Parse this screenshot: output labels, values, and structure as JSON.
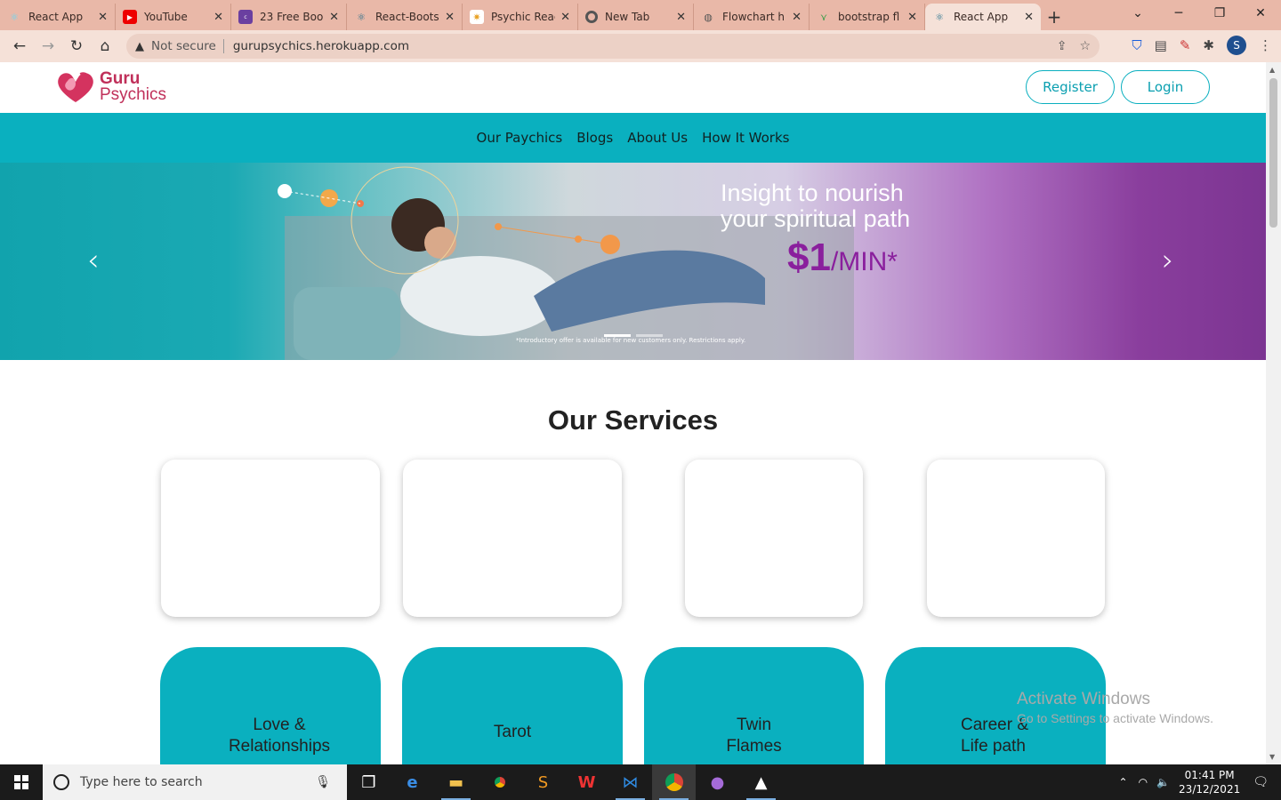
{
  "browser": {
    "tabs": [
      {
        "title": "React App",
        "icon": "react-icon",
        "active": false
      },
      {
        "title": "YouTube",
        "icon": "youtube-icon",
        "active": false
      },
      {
        "title": "23 Free Boo",
        "icon": "colorlib-icon",
        "active": false
      },
      {
        "title": "React-Boots",
        "icon": "react-icon",
        "active": false
      },
      {
        "title": "Psychic Reac",
        "icon": "psychic-icon",
        "active": false
      },
      {
        "title": "New Tab",
        "icon": "chrome-icon",
        "active": false
      },
      {
        "title": "Flowchart h",
        "icon": "globe-icon",
        "active": false
      },
      {
        "title": "bootstrap fl",
        "icon": "bootstrap-icon",
        "active": false
      },
      {
        "title": "React App",
        "icon": "react-icon",
        "active": true
      }
    ],
    "not_secure": "Not secure",
    "url": "gurupsychics.herokuapp.com",
    "profile_initial": "S"
  },
  "site": {
    "logo_line1": "Guru",
    "logo_line2": "Psychics",
    "register_label": "Register",
    "login_label": "Login",
    "nav": [
      "Our Paychics",
      "Blogs",
      "About Us",
      "How It Works"
    ],
    "hero": {
      "headline_1": "Insight to nourish",
      "headline_2": "your spiritual path",
      "price": "$1",
      "per": "/MIN*",
      "fine_print": "*Introductory offer is available for new customers only. Restrictions apply."
    },
    "services_title": "Our Services",
    "services": [
      {
        "line1": "Love &",
        "line2": "Relationships"
      },
      {
        "line1": "",
        "line2": "Tarot"
      },
      {
        "line1": "Twin",
        "line2": "Flames"
      },
      {
        "line1": "Career &",
        "line2": "Life path"
      }
    ]
  },
  "watermark": {
    "line1": "Activate Windows",
    "line2": "Go to Settings to activate Windows."
  },
  "taskbar": {
    "search_placeholder": "Type here to search",
    "time": "01:41 PM",
    "date": "23/12/2021"
  },
  "colors": {
    "teal": "#0ab0bf",
    "brand": "#c0305a",
    "tabbar": "#e9b8a8"
  }
}
